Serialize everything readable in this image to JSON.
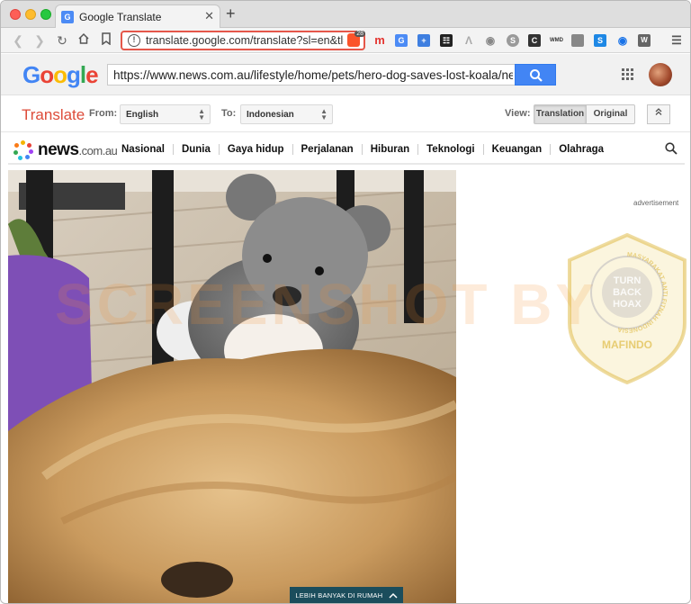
{
  "browser": {
    "tab_title": "Google Translate",
    "tab_favicon_text": "G",
    "url": "translate.google.com/translate?sl=en&tl=i...",
    "brave_badge": "28"
  },
  "google": {
    "logo": [
      "G",
      "o",
      "o",
      "g",
      "l",
      "e"
    ],
    "search_value": "https://www.news.com.au/lifestyle/home/pets/hero-dog-saves-lost-koala/news-stc"
  },
  "translate": {
    "title": "Translate",
    "from_label": "From:",
    "from_value": "English",
    "to_label": "To:",
    "to_value": "Indonesian",
    "view_label": "View:",
    "view_translation": "Translation",
    "view_original": "Original"
  },
  "news": {
    "logo_main": "news",
    "logo_suffix": ".com.au",
    "nav": [
      "Nasional",
      "Dunia",
      "Gaya hidup",
      "Perjalanan",
      "Hiburan",
      "Teknologi",
      "Keuangan",
      "Olahraga"
    ],
    "ad_label": "advertisement",
    "more_button": "LEBIH BANYAK DI RUMAH"
  },
  "overlay": {
    "watermark": "SCREENSHOT BY",
    "badge_ring": "MASYARAKAT ANTI FITNAH INDONESIA",
    "badge_lines": [
      "TURN",
      "BACK",
      "HOAX"
    ],
    "badge_org": "MAFINDO"
  },
  "colors": {
    "translate_red": "#dd4b39",
    "google_blue": "#4285f4",
    "more_button_bg": "#1b4d5c"
  }
}
